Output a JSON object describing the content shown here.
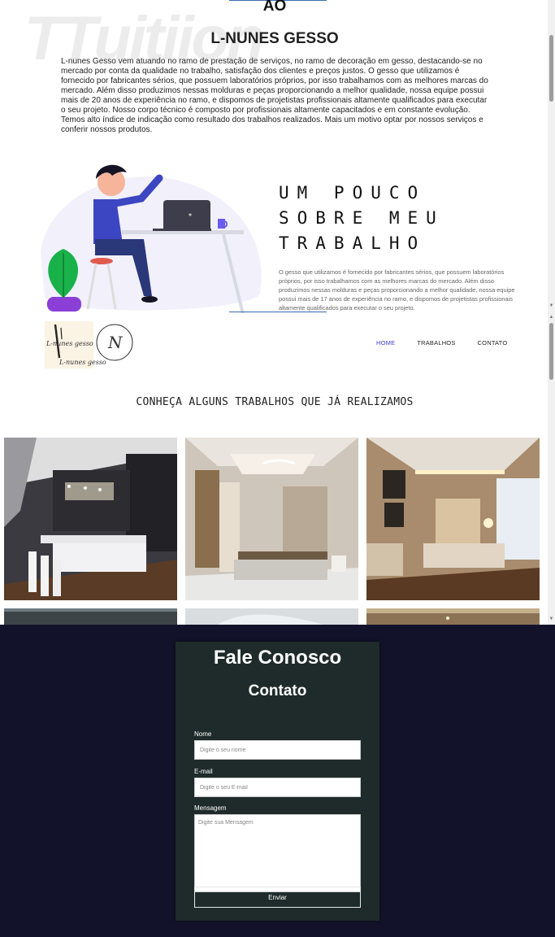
{
  "about": {
    "watermark": "TTuitiion",
    "heading_fragment": "AO",
    "brand_title": "L-NUNES GESSO",
    "intro": "L-nunes Gesso vem atuando no ramo de prestação de serviços, no ramo de decoração em gesso, destacando-se no mercado por conta da qualidade no trabalho, satisfação dos clientes e preços justos. O gesso que utilizamos é fornecido por fabricantes sérios, que possuem laboratórios próprios, por isso trabalhamos com as melhores marcas do mercado. Além disso produzimos nessas molduras e peças proporcionando a melhor qualidade, nossa equipe possui mais de 20 anos de experiência no ramo, e dispomos de projetistas profissionais altamente qualificados para executar o seu projeto. Nosso corpo técnico é composto por profissionais altamente capacitados e em constante evolução. Temos alto índice de indicação como resultado dos trabalhos realizados. Mais um motivo optar por nossos serviços e conferir nossos produtos.",
    "work_heading": [
      "UM POUCO",
      "SOBRE MEU",
      "TRABALHO"
    ],
    "work_text": "O gesso que utilizamos é fornecido por fabricantes sérios, que possuem laboratórios próprios, por isso trabalhamos com as melhores marcas do mercado. Além disso produzimos nessas molduras e peças proporcionando a melhor qualidade, nossa equipe possui mais de 17 anos de experiência no ramo, e dispomos de projetistas profissionais altamente qualificados para executar o seu projeto."
  },
  "header": {
    "logo_text_1": "L-nunes gesso",
    "logo_text_2": "L-nunes gesso",
    "logo_monogram": "N",
    "nav": [
      {
        "label": "HOME",
        "active": true
      },
      {
        "label": "TRABALHOS",
        "active": false
      },
      {
        "label": "CONTATO",
        "active": false
      }
    ]
  },
  "works": {
    "title": "CONHEÇA ALGUNS TRABALHOS QUE JÁ REALIZAMOS",
    "photos": [
      {
        "name": "kitchen-photo",
        "icon": "kitchen-ceiling-image"
      },
      {
        "name": "bedroom-photo-1",
        "icon": "bedroom-ceiling-image"
      },
      {
        "name": "bedroom-photo-2",
        "icon": "bedroom-lighting-image"
      },
      {
        "name": "ceiling-photo-1",
        "icon": "ceiling-image"
      },
      {
        "name": "ceiling-photo-2",
        "icon": "ceiling-image"
      },
      {
        "name": "ceiling-photo-3",
        "icon": "ceiling-image"
      }
    ]
  },
  "contact": {
    "title": "Fale Conosco",
    "subtitle": "Contato",
    "name_label": "Nome",
    "name_placeholder": "Digite o seu nome",
    "email_label": "E-mail",
    "email_placeholder": "Digite o seu E-mail",
    "message_label": "Mensagem",
    "message_placeholder": "Digite sua Mensagem",
    "submit_label": "Enviar"
  },
  "colors": {
    "accent": "#3b3bc4",
    "contact_bg": "#12132a",
    "card_bg": "#1e2b2a"
  }
}
